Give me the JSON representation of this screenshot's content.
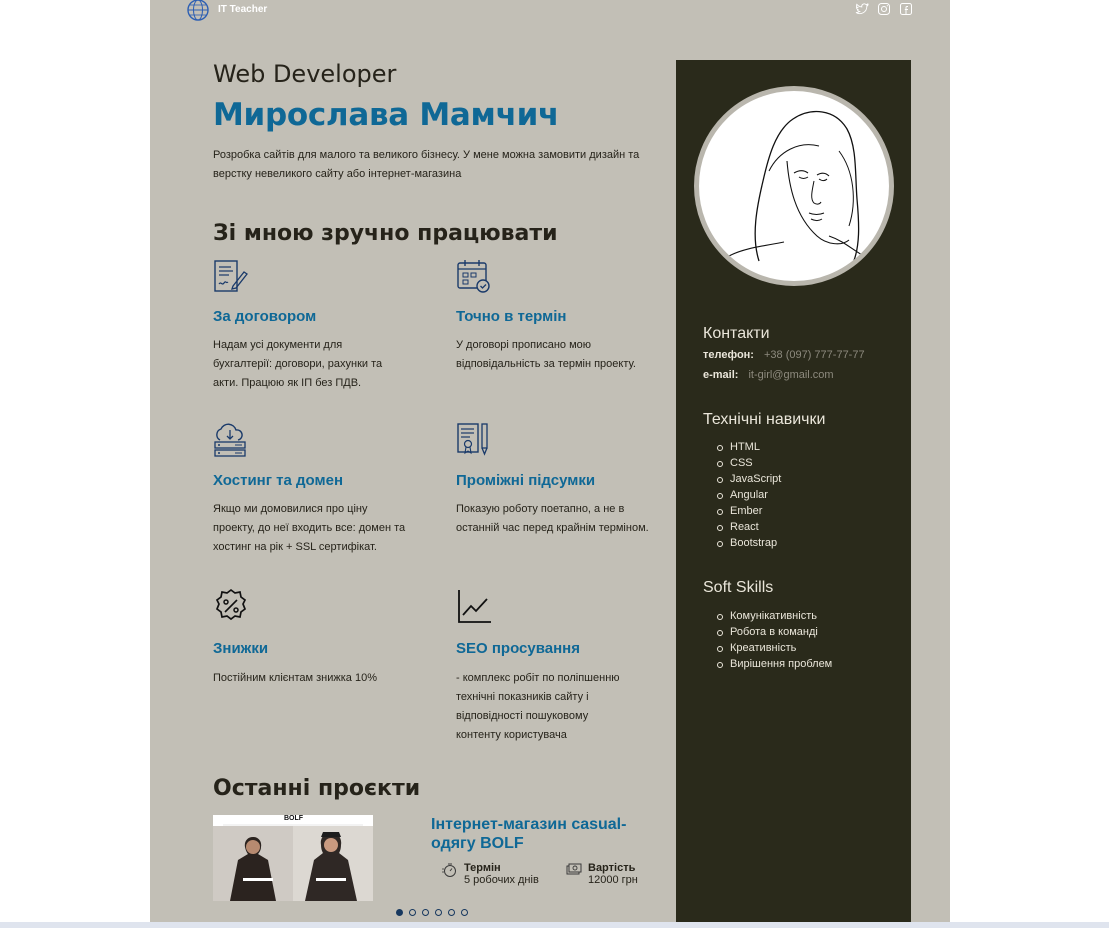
{
  "header": {
    "brand": "IT Teacher",
    "social": [
      "twitter-icon",
      "instagram-icon",
      "facebook-icon"
    ]
  },
  "hero": {
    "role": "Web Developer",
    "name": "Мирослава Мамчич",
    "intro": "Розробка сайтів для малого та великого бізнесу. У мене можна замовити дизайн та верстку невеликого сайту або інтернет-магазина"
  },
  "features": {
    "heading": "Зі мною зручно працювати",
    "items": [
      {
        "title": "За договором",
        "text": "Надам усі документи для бухгалтерії: договори, рахунки та акти. Працюю як ІП без ПДВ.",
        "icon": "contract-icon"
      },
      {
        "title": "Точно в термін",
        "text": "У договорі прописано мою відповідальність за термін проекту.",
        "icon": "calendar-icon"
      },
      {
        "title": "Хостинг та домен",
        "text": "Якщо ми домовилися про ціну проекту, до неї входить все: домен та хостинг на рік + SSL сертифікат.",
        "icon": "cloud-server-icon"
      },
      {
        "title": "Проміжні підсумки",
        "text": "Показую роботу поетапно, а не в останній час перед крайнім терміном.",
        "icon": "certificate-icon"
      },
      {
        "title": "Знижки",
        "text": "Постійним клієнтам знижка 10%",
        "icon": "discount-icon"
      },
      {
        "title": "SEO просування",
        "text": "- комплекс робіт по поліпшенню технічні показників сайту і відповідності пошуковому контенту користувача",
        "icon": "chart-icon"
      }
    ]
  },
  "projects": {
    "heading": "Останні проєкти",
    "current": {
      "title": "Інтернет-магазин casual-одягу BOLF",
      "image_logo": "BOLF",
      "term_label": "Термін",
      "term_value": "5 робочих днів",
      "price_label": "Вартість",
      "price_value": "12000 грн"
    },
    "slide_count": 6,
    "active_slide": 1
  },
  "sidebar": {
    "contacts": {
      "heading": "Контакти",
      "phone_label": "телефон:",
      "phone": "+38 (097) 777-77-77",
      "email_label": "e-mail:",
      "email": "it-girl@gmail.com"
    },
    "tech": {
      "heading": "Технічні навички",
      "items": [
        "HTML",
        "CSS",
        "JavaScript",
        "Angular",
        "Ember",
        "React",
        "Bootstrap"
      ]
    },
    "soft": {
      "heading": "Soft Skills",
      "items": [
        "Комунікативність",
        "Робота в команді",
        "Креативність",
        "Вирішення проблем"
      ]
    }
  },
  "colors": {
    "page_bg": "#c2bfb6",
    "sidebar_bg": "#2a2a1b",
    "accent": "#0f6896",
    "text": "#26231a"
  }
}
